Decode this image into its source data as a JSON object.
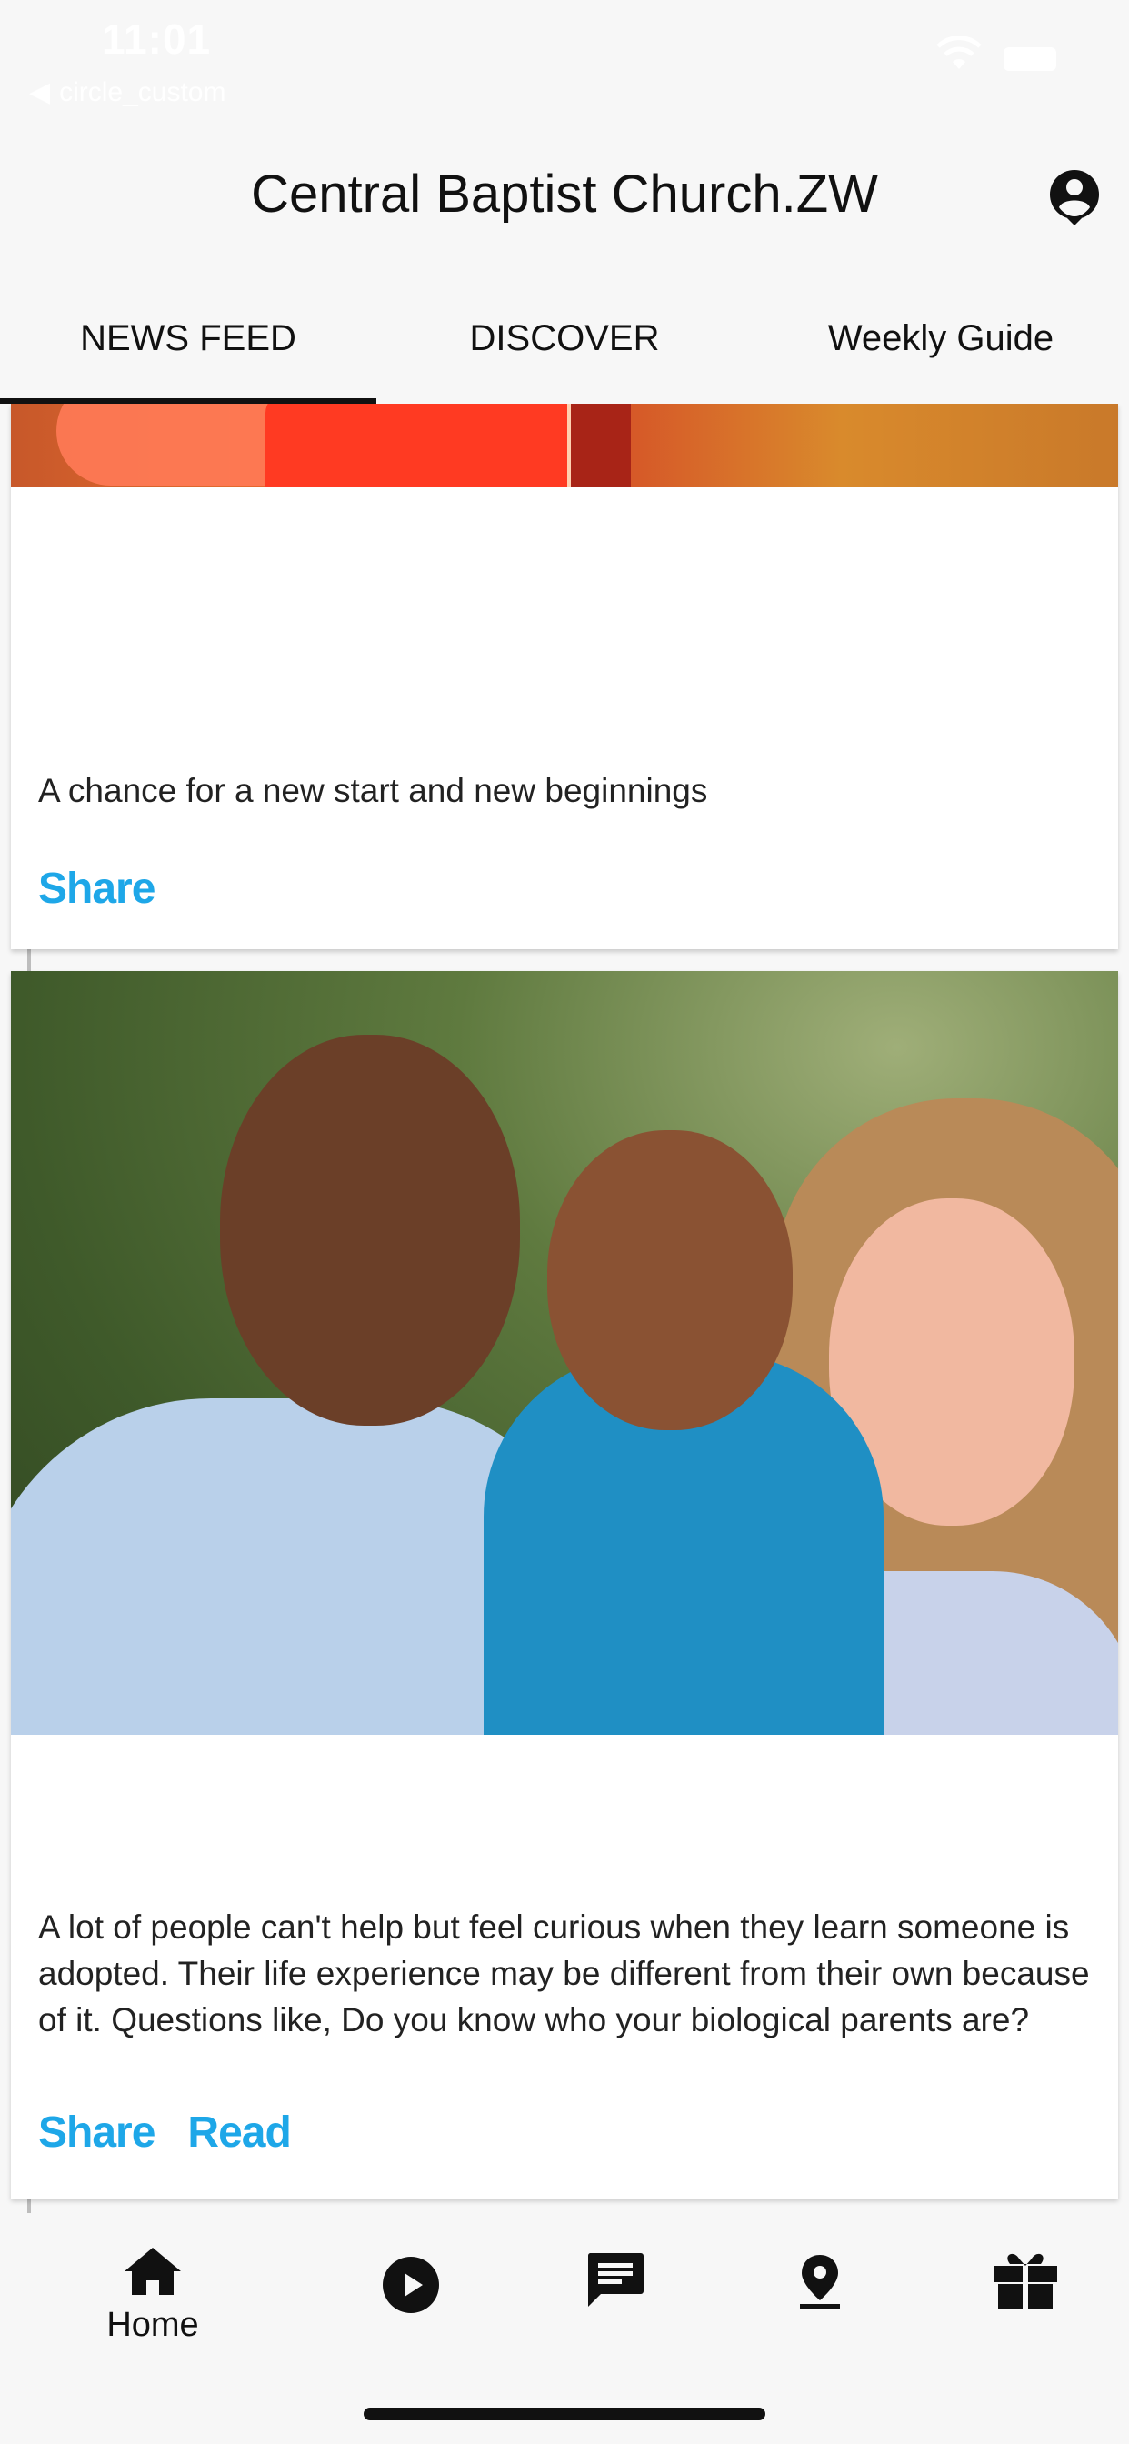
{
  "status_bar": {
    "time": "11:01",
    "back_label": "circle_custom"
  },
  "header": {
    "title": "Central Baptist Church.ZW",
    "profile_icon": "account-circle-icon"
  },
  "tabs": [
    {
      "label": "NEWS FEED",
      "active": true
    },
    {
      "label": "DISCOVER",
      "active": false
    },
    {
      "label": "Weekly Guide",
      "active": false
    }
  ],
  "feed": {
    "cards": [
      {
        "image": "autumn-photo-partial",
        "text": "A chance for a new start and new beginnings",
        "actions": [
          "Share"
        ]
      },
      {
        "image": "family-photo",
        "text": "A lot of people can't help but feel curious when they learn someone is adopted. Their life experience may be different from their own because of it. Questions like, Do you know who your biological parents are?",
        "actions": [
          "Share",
          "Read"
        ]
      }
    ]
  },
  "bottom_nav": {
    "items": [
      {
        "icon": "home-icon",
        "label": "Home",
        "active": true
      },
      {
        "icon": "play-circle-icon",
        "label": ""
      },
      {
        "icon": "message-icon",
        "label": ""
      },
      {
        "icon": "location-pin-icon",
        "label": ""
      },
      {
        "icon": "gift-icon",
        "label": ""
      }
    ]
  },
  "colors": {
    "accent": "#1ea7e8",
    "background": "#f7f7f7",
    "card": "#ffffff",
    "text": "#111111"
  }
}
